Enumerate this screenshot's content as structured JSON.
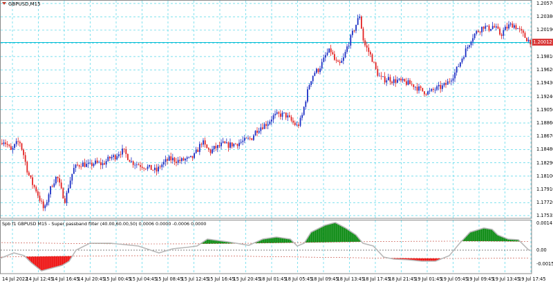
{
  "colors": {
    "grid": "#4fd6e8",
    "bull": "#1c2fc4",
    "bear": "#e32222",
    "ind_pos": "#0b8a12",
    "ind_neg": "#ee1111",
    "ind_line": "#b8b8b8",
    "band": "#c0392b",
    "current": "#00bcd4"
  },
  "header": {
    "symbol": "GBPUSD,M15",
    "dropdown_icon": "triangle-down-icon"
  },
  "price_axis": {
    "labels": [
      "1.20570",
      "1.20380",
      "1.20190",
      "1.20000",
      "1.19810",
      "1.19620",
      "1.19430",
      "1.19240",
      "1.19050",
      "1.18860",
      "1.18670",
      "1.18480",
      "1.18290",
      "1.18100",
      "1.17910",
      "1.17720",
      "1.17535"
    ],
    "current": "1.20012"
  },
  "indicator": {
    "title": "Spb f1 GBPUSD M15 - Super passband filter (40.00,60.00,50) 0.0006 0.0000 -0.0006 0.0000",
    "axis_labels": [
      "0.0014",
      "0.00",
      "-0.0015"
    ]
  },
  "time_axis": {
    "labels": [
      "14 Jul 2022",
      "14 Jul 12:45",
      "14 Jul 16:45",
      "14 Jul 20:45",
      "15 Jul 00:45",
      "15 Jul 04:45",
      "15 Jul 08:45",
      "15 Jul 12:45",
      "15 Jul 16:45",
      "15 Jul 20:45",
      "18 Jul 01:45",
      "18 Jul 05:45",
      "18 Jul 09:45",
      "18 Jul 13:45",
      "18 Jul 17:45",
      "18 Jul 21:45",
      "19 Jul 01:45",
      "19 Jul 05:45",
      "19 Jul 09:45",
      "19 Jul 13:45",
      "19 Jul 17:45"
    ]
  },
  "chart_data": {
    "type": "candlestick",
    "symbol": "GBPUSD",
    "timeframe": "M15",
    "ylim": [
      1.17535,
      1.2057
    ],
    "current_price": 1.20012,
    "path": [
      [
        0,
        1.1855
      ],
      [
        6,
        1.1862
      ],
      [
        12,
        1.1855
      ],
      [
        18,
        1.1845
      ],
      [
        24,
        1.1855
      ],
      [
        30,
        1.186
      ],
      [
        36,
        1.184
      ],
      [
        42,
        1.1815
      ],
      [
        48,
        1.18
      ],
      [
        54,
        1.179
      ],
      [
        60,
        1.1775
      ],
      [
        66,
        1.176
      ],
      [
        72,
        1.1785
      ],
      [
        78,
        1.18
      ],
      [
        84,
        1.181
      ],
      [
        90,
        1.179
      ],
      [
        96,
        1.1775
      ],
      [
        102,
        1.18
      ],
      [
        108,
        1.182
      ],
      [
        114,
        1.1825
      ],
      [
        120,
        1.1828
      ],
      [
        126,
        1.1826
      ],
      [
        132,
        1.1825
      ],
      [
        138,
        1.1829
      ],
      [
        144,
        1.1828
      ],
      [
        150,
        1.1827
      ],
      [
        156,
        1.1832
      ],
      [
        162,
        1.1837
      ],
      [
        168,
        1.1838
      ],
      [
        174,
        1.1844
      ],
      [
        180,
        1.1846
      ],
      [
        186,
        1.1838
      ],
      [
        192,
        1.183
      ],
      [
        198,
        1.1828
      ],
      [
        204,
        1.1826
      ],
      [
        210,
        1.1824
      ],
      [
        216,
        1.1822
      ],
      [
        222,
        1.182
      ],
      [
        228,
        1.1817
      ],
      [
        234,
        1.1825
      ],
      [
        240,
        1.183
      ],
      [
        246,
        1.1834
      ],
      [
        252,
        1.1834
      ],
      [
        258,
        1.1832
      ],
      [
        264,
        1.1832
      ],
      [
        270,
        1.1834
      ],
      [
        276,
        1.1834
      ],
      [
        282,
        1.1838
      ],
      [
        288,
        1.1848
      ],
      [
        294,
        1.186
      ],
      [
        300,
        1.185
      ],
      [
        306,
        1.1845
      ],
      [
        312,
        1.185
      ],
      [
        318,
        1.1852
      ],
      [
        324,
        1.1856
      ],
      [
        330,
        1.1854
      ],
      [
        336,
        1.1855
      ],
      [
        342,
        1.1856
      ],
      [
        348,
        1.1858
      ],
      [
        354,
        1.186
      ],
      [
        360,
        1.1862
      ],
      [
        366,
        1.1865
      ],
      [
        372,
        1.1875
      ],
      [
        378,
        1.188
      ],
      [
        384,
        1.1883
      ],
      [
        390,
        1.1887
      ],
      [
        396,
        1.1895
      ],
      [
        402,
        1.1897
      ],
      [
        408,
        1.1898
      ],
      [
        414,
        1.1898
      ],
      [
        420,
        1.1892
      ],
      [
        426,
        1.1886
      ],
      [
        432,
        1.1881
      ],
      [
        438,
        1.1893
      ],
      [
        444,
        1.192
      ],
      [
        450,
        1.1945
      ],
      [
        456,
        1.1958
      ],
      [
        462,
        1.1962
      ],
      [
        468,
        1.1972
      ],
      [
        474,
        1.1985
      ],
      [
        480,
        1.199
      ],
      [
        486,
        1.1975
      ],
      [
        492,
        1.1968
      ],
      [
        498,
        1.1976
      ],
      [
        504,
        1.1995
      ],
      [
        510,
        1.201
      ],
      [
        516,
        1.2025
      ],
      [
        522,
        1.204
      ],
      [
        528,
        1.2
      ],
      [
        534,
        1.199
      ],
      [
        540,
        1.1978
      ],
      [
        546,
        1.196
      ],
      [
        552,
        1.195
      ],
      [
        558,
        1.1948
      ],
      [
        564,
        1.195
      ],
      [
        570,
        1.1946
      ],
      [
        576,
        1.1947
      ],
      [
        582,
        1.1945
      ],
      [
        588,
        1.1944
      ],
      [
        594,
        1.1942
      ],
      [
        600,
        1.194
      ],
      [
        606,
        1.1936
      ],
      [
        612,
        1.1932
      ],
      [
        618,
        1.193
      ],
      [
        624,
        1.193
      ],
      [
        630,
        1.1934
      ],
      [
        636,
        1.1936
      ],
      [
        642,
        1.1938
      ],
      [
        648,
        1.1942
      ],
      [
        654,
        1.195
      ],
      [
        660,
        1.1958
      ],
      [
        666,
        1.197
      ],
      [
        672,
        1.1983
      ],
      [
        678,
        1.1995
      ],
      [
        684,
        1.2008
      ],
      [
        690,
        1.2015
      ],
      [
        696,
        1.202
      ],
      [
        702,
        1.2025
      ],
      [
        708,
        1.202
      ],
      [
        714,
        1.2025
      ],
      [
        720,
        1.202
      ],
      [
        726,
        1.2012
      ],
      [
        732,
        1.202
      ],
      [
        738,
        1.2025
      ],
      [
        744,
        1.2027
      ],
      [
        750,
        1.2022
      ],
      [
        756,
        1.2015
      ],
      [
        762,
        1.2008
      ],
      [
        768,
        1.2003
      ]
    ]
  }
}
